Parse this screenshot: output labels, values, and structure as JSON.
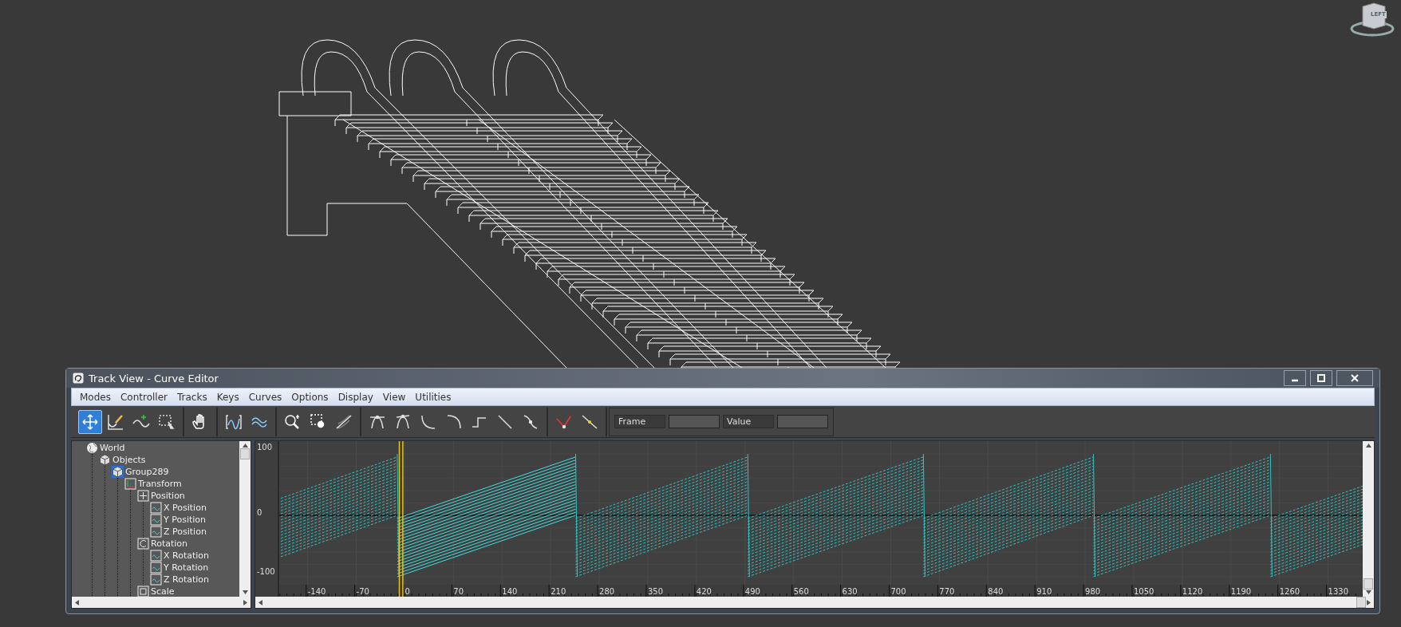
{
  "viewcube": {
    "face_label": "LEFT"
  },
  "window": {
    "title": "Track View - Curve Editor"
  },
  "menu": [
    "Modes",
    "Controller",
    "Tracks",
    "Keys",
    "Curves",
    "Options",
    "Display",
    "View",
    "Utilities"
  ],
  "toolbar": {
    "groups": [
      [
        {
          "kind": "move",
          "selected": true
        },
        {
          "kind": "draw",
          "selected": false
        },
        {
          "kind": "add",
          "selected": false
        },
        {
          "kind": "region",
          "selected": false
        }
      ],
      [
        {
          "kind": "pan",
          "selected": false
        }
      ],
      [
        {
          "kind": "frame-horizontal",
          "selected": false
        },
        {
          "kind": "frame-value",
          "selected": false
        }
      ],
      [
        {
          "kind": "zoom",
          "selected": false
        },
        {
          "kind": "zoom-region",
          "selected": false
        },
        {
          "kind": "isolate",
          "selected": false
        }
      ],
      [
        {
          "kind": "auto",
          "selected": false
        },
        {
          "kind": "custom",
          "selected": false
        },
        {
          "kind": "fast",
          "selected": false
        },
        {
          "kind": "slow",
          "selected": false
        },
        {
          "kind": "step",
          "selected": false
        },
        {
          "kind": "linear",
          "selected": false
        },
        {
          "kind": "smooth",
          "selected": false
        }
      ],
      [
        {
          "kind": "broken",
          "selected": false
        },
        {
          "kind": "unified",
          "selected": false
        }
      ]
    ],
    "frame_label": "Frame",
    "value_label": "Value"
  },
  "tree": [
    {
      "label": "World",
      "kind": "world",
      "selected": false,
      "children": [
        {
          "label": "Objects",
          "kind": "object",
          "selected": false,
          "children": [
            {
              "label": "Group289",
              "kind": "object",
              "selected": true,
              "children": [
                {
                  "label": "Transform",
                  "kind": "transform",
                  "selected": false,
                  "children": [
                    {
                      "label": "Position",
                      "kind": "position",
                      "selected": false,
                      "children": [
                        {
                          "label": "X Position",
                          "kind": "curve",
                          "selected": false
                        },
                        {
                          "label": "Y Position",
                          "kind": "curve",
                          "selected": false
                        },
                        {
                          "label": "Z Position",
                          "kind": "curve",
                          "selected": false
                        }
                      ]
                    },
                    {
                      "label": "Rotation",
                      "kind": "rotation",
                      "selected": false,
                      "children": [
                        {
                          "label": "X Rotation",
                          "kind": "curve",
                          "selected": false
                        },
                        {
                          "label": "Y Rotation",
                          "kind": "curve",
                          "selected": false
                        },
                        {
                          "label": "Z Rotation",
                          "kind": "curve",
                          "selected": false
                        }
                      ]
                    },
                    {
                      "label": "Scale",
                      "kind": "scale",
                      "selected": false
                    }
                  ]
                }
              ]
            }
          ]
        }
      ]
    }
  ],
  "graph": {
    "y_labels": [
      "100",
      "0",
      "-100"
    ],
    "x_labels": [
      "-140",
      "-70",
      "0",
      "70",
      "140",
      "210",
      "280",
      "350",
      "420",
      "490",
      "560",
      "630",
      "700",
      "770",
      "840",
      "910",
      "980",
      "1050",
      "1120",
      "1190",
      "1260",
      "1330"
    ]
  }
}
